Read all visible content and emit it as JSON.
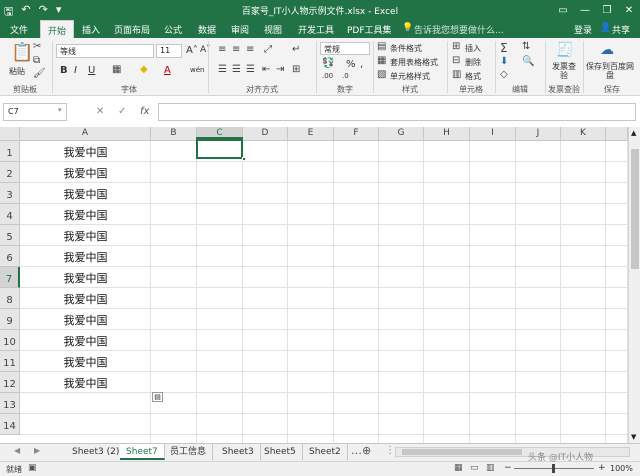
{
  "titlebar": {
    "title": "百家号_IT小人物示例文件.xlsx - Excel",
    "save_icon": "save-icon",
    "undo": "↶",
    "redo": "↷",
    "minimize": "—",
    "restore": "❐",
    "close": "✕",
    "ribbon_opts": "▭"
  },
  "tabs": {
    "file": "文件",
    "home": "开始",
    "insert": "插入",
    "layout": "页面布局",
    "formulas": "公式",
    "data": "数据",
    "review": "审阅",
    "view": "视图",
    "developer": "开发工具",
    "pdf": "PDF工具集",
    "tellme": "告诉我您想要做什么...",
    "login": "登录",
    "share": "共享"
  },
  "ribbon": {
    "paste": "粘贴",
    "clipboard": "剪贴板",
    "font_name": "等线",
    "font_size": "11",
    "font_group": "字体",
    "align_group": "对齐方式",
    "number_format": "常规",
    "number_group": "数字",
    "cond_format": "条件格式",
    "table_format": "套用表格格式",
    "cell_style": "单元格样式",
    "style_group": "样式",
    "insert": "插入",
    "delete": "删除",
    "format": "格式",
    "cells_group": "单元格",
    "edit_group": "编辑",
    "invoice": "发票查验",
    "invoice_btn": "发票查验",
    "save_to": "保存到百度网盘",
    "save_group": "保存"
  },
  "formula": {
    "name_box": "C7",
    "cancel": "✕",
    "enter": "✓",
    "fx": "fx",
    "value": ""
  },
  "columns": [
    "A",
    "B",
    "C",
    "D",
    "E",
    "F",
    "G",
    "H",
    "I",
    "J",
    "K"
  ],
  "rows": [
    "1",
    "2",
    "3",
    "4",
    "5",
    "6",
    "7",
    "8",
    "9",
    "10",
    "11",
    "12",
    "13",
    "14"
  ],
  "cells": [
    "我爱中国",
    "我爱中国",
    "我爱中国",
    "我爱中国",
    "我爱中国",
    "我爱中国",
    "我爱中国",
    "我爱中国",
    "我爱中国",
    "我爱中国",
    "我爱中国",
    "我爱中国"
  ],
  "sheets": [
    "Sheet3 (2)",
    "Sheet7",
    "员工信息",
    "Sheet3",
    "Sheet5",
    "Sheet2"
  ],
  "active_sheet": "Sheet7",
  "status": {
    "ready": "就绪",
    "zoom": "100%",
    "watermark": "头条 @IT小人物"
  },
  "colors": {
    "accent": "#217346"
  }
}
